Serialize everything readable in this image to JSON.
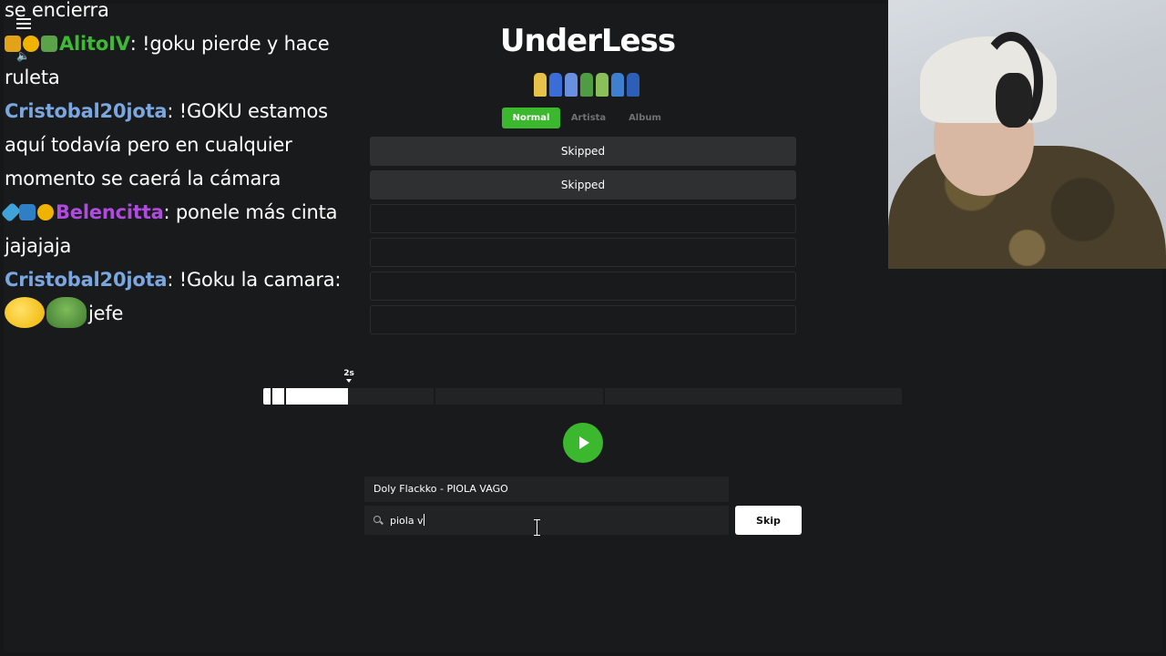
{
  "chat": {
    "line0": "se encierra",
    "line1_user": "AlitoIV",
    "line1_msg": ": !goku pierde y hace",
    "line1b": "ruleta",
    "line2_user": "Cristobal20jota",
    "line2_msg": ": !GOKU estamos",
    "line2b": "aquí todavía pero en cualquier",
    "line2c": "momento se caerá la cámara",
    "line3_user": "Belencitta",
    "line3_msg": ": ponele más cinta",
    "line3b": "jajajaja",
    "line4_user": "Cristobal20jota",
    "line4_msg": ": !Goku la camara:",
    "line4b": "jefe",
    "colors": {
      "alito": "#3fb935",
      "cristobal": "#7ba7e0",
      "belen": "#b04be0"
    }
  },
  "game": {
    "title": "UnderLess",
    "tabs": [
      "Normal",
      "Artista",
      "Album"
    ],
    "guesses": [
      "Skipped",
      "Skipped",
      "",
      "",
      "",
      ""
    ],
    "timer_label": "2s",
    "progress_fraction": 0.133,
    "suggestion": "Doly Flackko - PIOLA VAGO",
    "search_value": "piola v",
    "skip_label": "Skip",
    "accent": "#3cb82f"
  }
}
